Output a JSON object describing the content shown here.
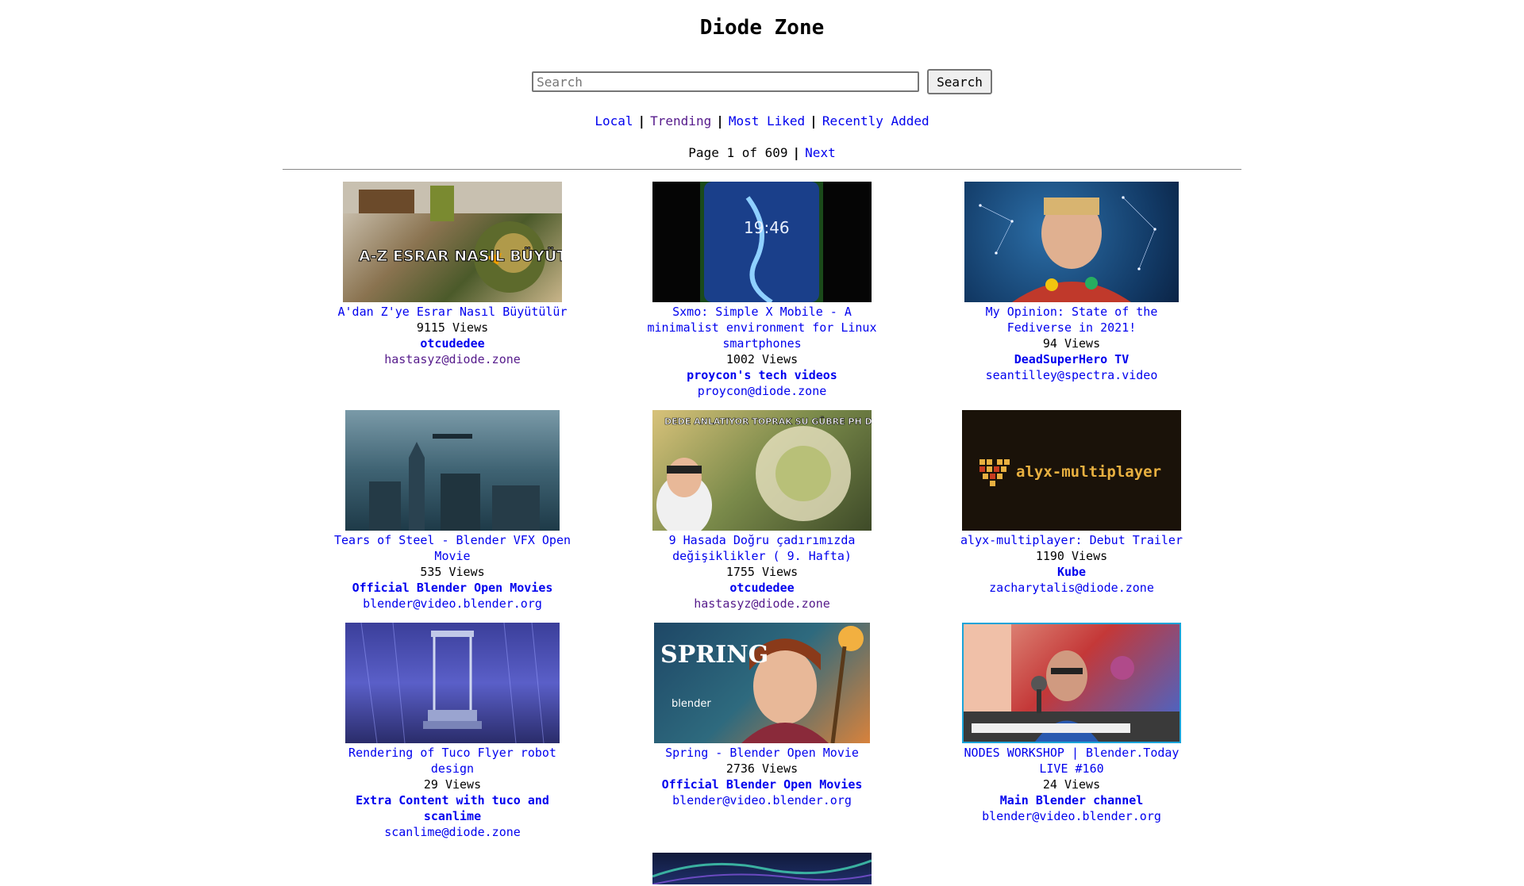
{
  "site": {
    "title": "Diode Zone"
  },
  "search": {
    "placeholder": "Search",
    "button_label": "Search"
  },
  "nav": {
    "local": "Local",
    "trending": "Trending",
    "most_liked": "Most Liked",
    "recently_added": "Recently Added",
    "separator": "|"
  },
  "pager": {
    "text": "Page 1 of 609",
    "separator": "|",
    "next": "Next"
  },
  "videos": [
    {
      "title": "A'dan Z'ye Esrar Nasıl Büyütülür",
      "views": "9115 Views",
      "channel": "otcudedee",
      "account": "hastasyz@diode.zone",
      "thumb_text": "A-Z ESRAR NASIL BÜYÜTÜLÜR"
    },
    {
      "title": "Sxmo: Simple X Mobile - A minimalist environment for Linux smartphones",
      "views": "1002 Views",
      "channel": "proycon's tech videos",
      "account": "proycon@diode.zone",
      "thumb_text": "19:46"
    },
    {
      "title": "My Opinion: State of the Fediverse in 2021!",
      "views": "94 Views",
      "channel": "DeadSuperHero TV",
      "account": "seantilley@spectra.video"
    },
    {
      "title": "Tears of Steel - Blender VFX Open Movie",
      "views": "535 Views",
      "channel": "Official Blender Open Movies",
      "account": "blender@video.blender.org"
    },
    {
      "title": "9 Hasada Doğru çadırımızda değişiklikler ( 9. Hafta)",
      "views": "1755 Views",
      "channel": "otcudedee",
      "account": "hastasyz@diode.zone",
      "thumb_text": "DEDE ANLATIYOR TOPRAK SU GÜBRE PH DENGESİ"
    },
    {
      "title": "alyx-multiplayer: Debut Trailer",
      "views": "1190 Views",
      "channel": "Kube",
      "account": "zacharytalis@diode.zone",
      "thumb_text": "alyx-multiplayer"
    },
    {
      "title": "Rendering of Tuco Flyer robot design",
      "views": "29 Views",
      "channel": "Extra Content with tuco and scanlime",
      "account": "scanlime@diode.zone"
    },
    {
      "title": "Spring - Blender Open Movie",
      "views": "2736 Views",
      "channel": "Official Blender Open Movies",
      "account": "blender@video.blender.org",
      "thumb_text": "SPRING",
      "thumb_sub": "blender"
    },
    {
      "title": "NODES WORKSHOP | Blender.Today LIVE #160",
      "views": "24 Views",
      "channel": "Main Blender channel",
      "account": "blender@video.blender.org"
    }
  ]
}
